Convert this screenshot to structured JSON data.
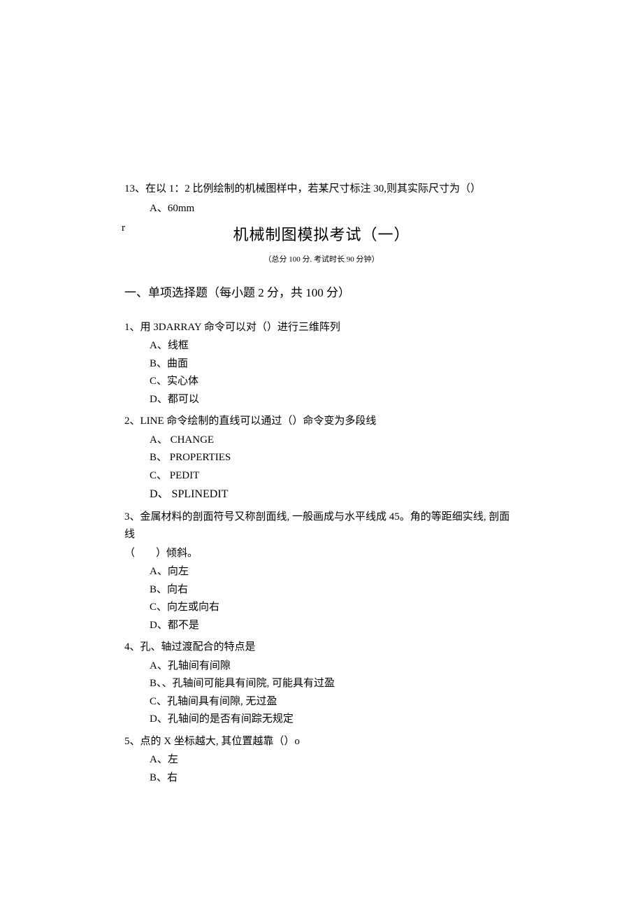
{
  "q13": {
    "text": "13、在以 1：2 比例绘制的机械图样中，若某尺寸标注 30,则其实际尺寸为（）",
    "optA": "A、60mm"
  },
  "stray": "r",
  "title": "机械制图模拟考试（一）",
  "subtitle": "（总分 100 分. 考试时长 90 分钟）",
  "section": "一、单项选择题（每小题 2 分，共 100 分）",
  "questions": {
    "q1": {
      "line": "1、用 3DARRAY 命令可以对（）进行三维阵列",
      "A": "A、线框",
      "B": "B、曲面",
      "C": "C、实心体",
      "D": "D、都可以"
    },
    "q2": {
      "line": "2、LINE 命令绘制的直线可以通过（）命令变为多段线",
      "A": "A、 CHANGE",
      "B": "B、 PROPERTIES",
      "C": "C、 PEDIT",
      "Dprefix": "D、 S",
      "Drest": "PLINEDIT"
    },
    "q3": {
      "line1": "3、金属材料的剖面符号又称剖面线, 一般画成与水平线成 45。角的等距细实线, 剖面线",
      "line2": "（　　）倾斜。",
      "A": "A、向左",
      "B": "B、向右",
      "C": "C、向左或向右",
      "D": "D、都不是"
    },
    "q4": {
      "line": "4、孔、轴过渡配合的特点是",
      "A": "A、孔轴间有间隙",
      "B": "B、、孔轴间可能具有间院, 可能具有过盈",
      "C": "C、孔轴间具有间隙, 无过盈",
      "D": "D、孔轴间的是否有间踪无规定"
    },
    "q5": {
      "line": "5、点的 X 坐标越大, 其位置越靠（）o",
      "A": "A、左",
      "B": "B、右"
    }
  }
}
